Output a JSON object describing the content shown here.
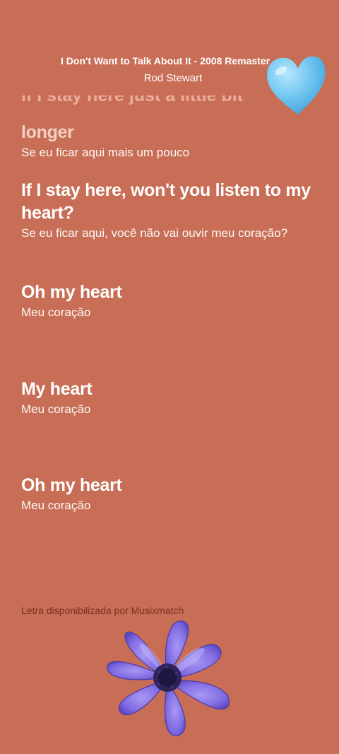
{
  "header": {
    "song_title": "I Don't Want to Talk About It - 2008 Remaster",
    "artist": "Rod Stewart"
  },
  "lyrics": {
    "faded_line": "If I stay here just a little bit",
    "lines": [
      {
        "original": "longer",
        "translation": "Se eu ficar aqui mais um pouco"
      },
      {
        "original": "If I stay here, won't you listen to my heart?",
        "translation": "Se eu ficar aqui, você não vai ouvir meu coração?"
      },
      {
        "original": "Oh my heart",
        "translation": "Meu coração"
      },
      {
        "original": "My heart",
        "translation": "Meu coração"
      },
      {
        "original": "Oh my heart",
        "translation": "Meu coração"
      }
    ]
  },
  "footer": {
    "credit": "Letra disponibilizada por Musixmatch"
  },
  "stickers": {
    "heart": "blue-heart-sticker",
    "flower": "purple-flower-sticker"
  },
  "colors": {
    "background": "#c96e56",
    "heart": "#74c8f2",
    "flower": "#8b7ae6",
    "credit_text": "#7a2f24"
  }
}
